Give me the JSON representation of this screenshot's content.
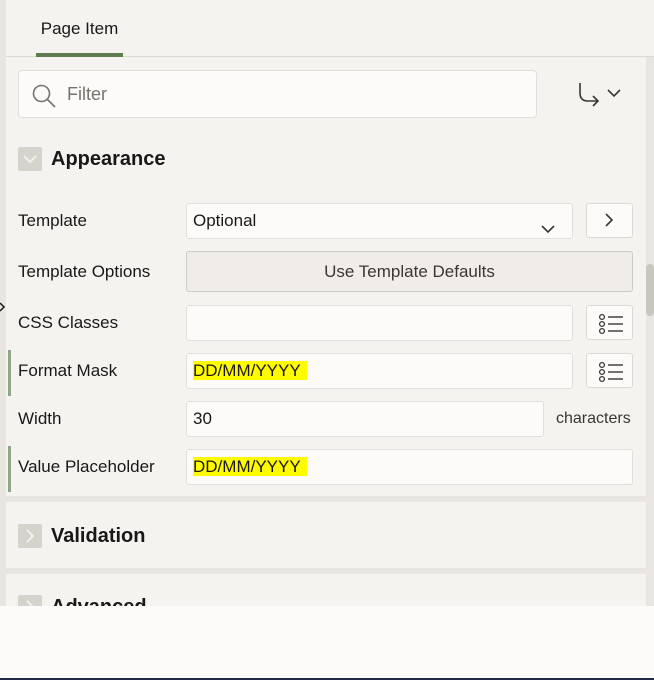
{
  "tabs": [
    {
      "label": "Page Item",
      "active": true
    }
  ],
  "filter": {
    "placeholder": "Filter",
    "value": ""
  },
  "sections": {
    "appearance": {
      "title": "Appearance",
      "expanded": true,
      "properties": {
        "template": {
          "label": "Template",
          "value": "Optional"
        },
        "template_options": {
          "label": "Template Options",
          "button_label": "Use Template Defaults"
        },
        "css_classes": {
          "label": "CSS Classes",
          "value": ""
        },
        "format_mask": {
          "label": "Format Mask",
          "value": "DD/MM/YYYY"
        },
        "width": {
          "label": "Width",
          "value": "30",
          "unit": "characters"
        },
        "value_placeholder": {
          "label": "Value Placeholder",
          "value": "DD/MM/YYYY"
        }
      }
    },
    "validation": {
      "title": "Validation",
      "expanded": false
    },
    "advanced": {
      "title": "Advanced",
      "expanded": false
    }
  },
  "colors": {
    "accent": "#5f7d4f",
    "highlight": "#fffc00",
    "changed_marker": "#8fa58a"
  }
}
